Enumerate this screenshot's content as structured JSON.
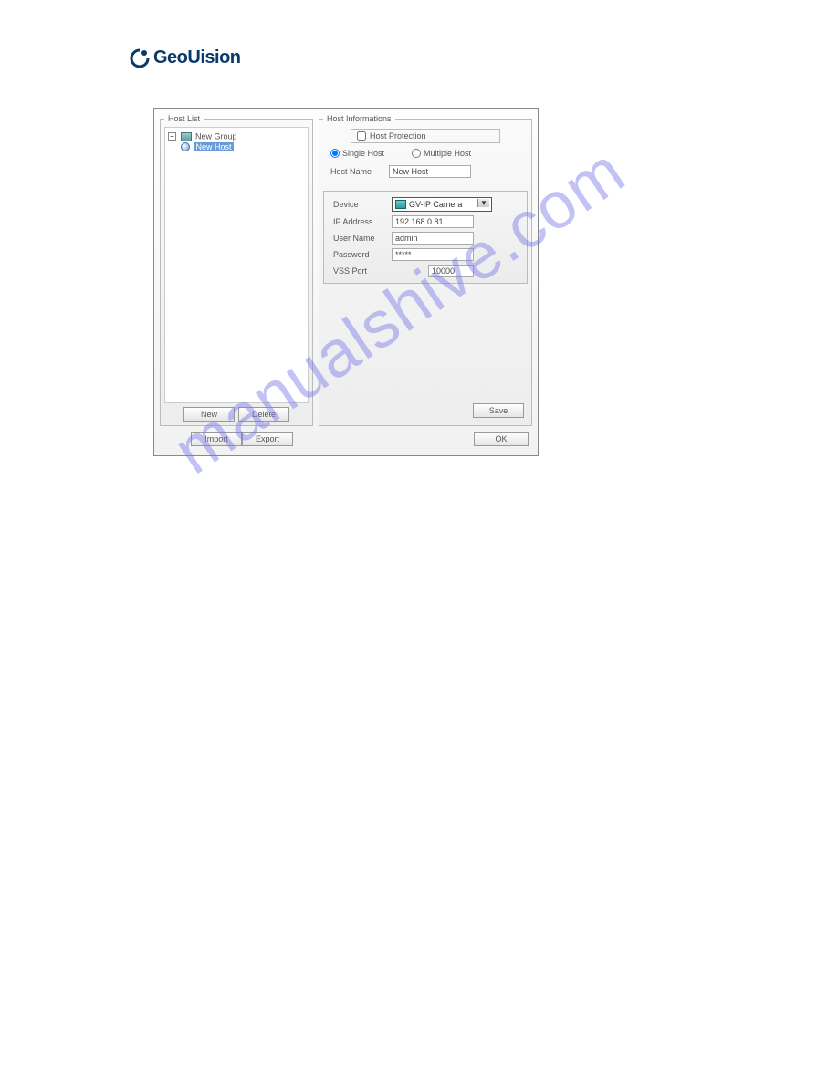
{
  "brand": {
    "name": "GeoUision"
  },
  "dialog": {
    "hostlist": {
      "legend": "Host List",
      "tree": {
        "group_label": "New Group",
        "host_label": "New Host"
      },
      "new_btn": "New",
      "delete_btn": "Delete"
    },
    "hostinfo": {
      "legend": "Host Informations",
      "protection_label": "Host Protection",
      "protection_checked": false,
      "single_label": "Single Host",
      "multiple_label": "Multiple Host",
      "mode": "single",
      "hostname_label": "Host Name",
      "hostname_value": "New Host",
      "device_label": "Device",
      "device_value": "GV-IP Camera",
      "ip_label": "IP Address",
      "ip_value": "192.168.0.81",
      "user_label": "User Name",
      "user_value": "admin",
      "password_label": "Password",
      "password_value": "*****",
      "vss_label": "VSS Port",
      "vss_value": "10000",
      "save_btn": "Save"
    },
    "import_btn": "Import",
    "export_btn": "Export",
    "ok_btn": "OK"
  },
  "watermark": "manualshive.com",
  "page_number": ""
}
